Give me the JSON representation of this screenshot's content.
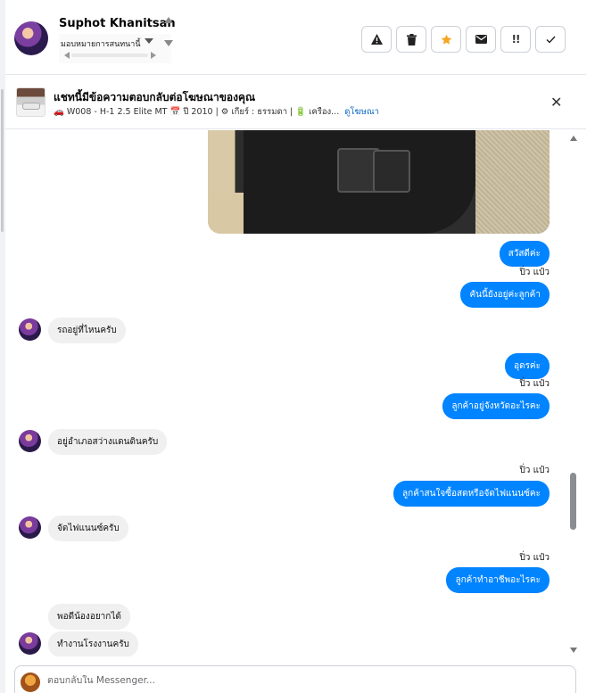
{
  "header": {
    "contact_name": "Suphot Khanitsan",
    "assign_label": "มอบหมายการสนทนานี้",
    "actions": [
      {
        "icon": "warning-icon",
        "label": "⚠"
      },
      {
        "icon": "trash-icon",
        "label": "🗑"
      },
      {
        "icon": "star-icon",
        "label": "★"
      },
      {
        "icon": "envelope-icon",
        "label": "✉"
      },
      {
        "icon": "exclamation-icon",
        "label": "!!"
      },
      {
        "icon": "check-icon",
        "label": "✓"
      }
    ]
  },
  "ad": {
    "title": "แชทนี้มีข้อความตอบกลับต่อโฆษณาของคุณ",
    "subtitle": "🚗 W008 - H-1 2.5 Elite MT 📅 ปี 2010 | ⚙ เกียร์ : ธรรมดา | 🔋 เครือง...",
    "link": "ดูโฆษณา"
  },
  "messages": {
    "m1": "สวัสดีค่ะ",
    "s1": "ปิ่ว แป๋ว",
    "m2": "คันนี้ยังอยู่ค่ะลูกค้า",
    "m3": "รถอยู่ที่ไหนครับ",
    "m4": "อุดรค่ะ",
    "s2": "ปิ่ว แป๋ว",
    "m5": "ลูกค้าอยู่จังหวัดอะไรคะ",
    "m6": "อยู่อำเภอสว่างแดนดินครับ",
    "s3": "ปิ่ว แป๋ว",
    "m7": "ลูกค้าสนใจซื้อสดหรือจัดไฟแนนซ์คะ",
    "m8": "จัดไฟแนนซ์ครับ",
    "s4": "ปิ่ว แป๋ว",
    "m9": "ลูกค้าทำอาชีพอะไรคะ",
    "m10": "พอดีน้องอยากได้",
    "m11": "ทำงานโรงงานครับ"
  },
  "composer": {
    "placeholder": "ตอบกลับใน Messenger..."
  },
  "colors": {
    "outgoing_bubble": "#0084ff",
    "incoming_bubble": "#f0f0f0",
    "star": "#f5a623"
  }
}
